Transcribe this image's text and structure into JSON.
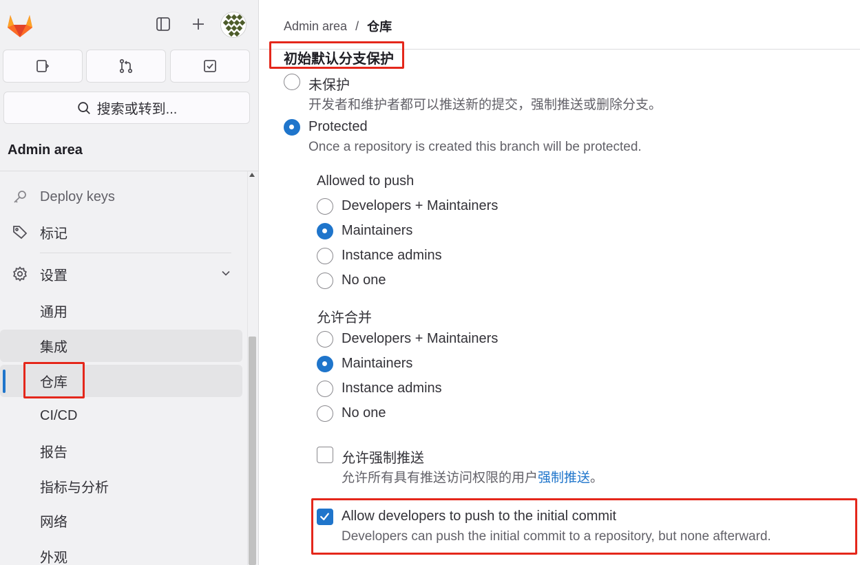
{
  "sidebar": {
    "search_placeholder": "搜索或转到...",
    "section_title": "Admin area",
    "items": {
      "deploy_keys": "Deploy keys",
      "labels": "标记",
      "settings": "设置"
    },
    "settings_sub": {
      "general": "通用",
      "integrations": "集成",
      "repository": "仓库",
      "cicd": "CI/CD",
      "reports": "报告",
      "metrics": "指标与分析",
      "network": "网络",
      "appearance": "外观"
    }
  },
  "breadcrumb": {
    "root": "Admin area",
    "separator": "/",
    "current": "仓库"
  },
  "protection": {
    "title": "初始默认分支保护",
    "unprotected_label": "未保护",
    "unprotected_help": "开发者和维护者都可以推送新的提交，强制推送或删除分支。",
    "protected_label": "Protected",
    "protected_help": "Once a repository is created this branch will be protected.",
    "selected": "protected",
    "allowed_to_push": {
      "label": "Allowed to push",
      "options": [
        "Developers + Maintainers",
        "Maintainers",
        "Instance admins",
        "No one"
      ],
      "selected": "Maintainers"
    },
    "allowed_to_merge": {
      "label": "允许合并",
      "options": [
        "Developers + Maintainers",
        "Maintainers",
        "Instance admins",
        "No one"
      ],
      "selected": "Maintainers"
    },
    "force_push": {
      "checked": false,
      "label": "允许强制推送",
      "help_prefix": "允许所有具有推送访问权限的用户",
      "help_link": "强制推送",
      "help_suffix": "。"
    },
    "initial_commit": {
      "checked": true,
      "label": "Allow developers to push to the initial commit",
      "help": "Developers can push the initial commit to a repository, but none afterward."
    }
  },
  "colors": {
    "accent": "#1f75cb",
    "highlight": "#e4271b",
    "sidebar_bg": "#f1f1f3"
  }
}
